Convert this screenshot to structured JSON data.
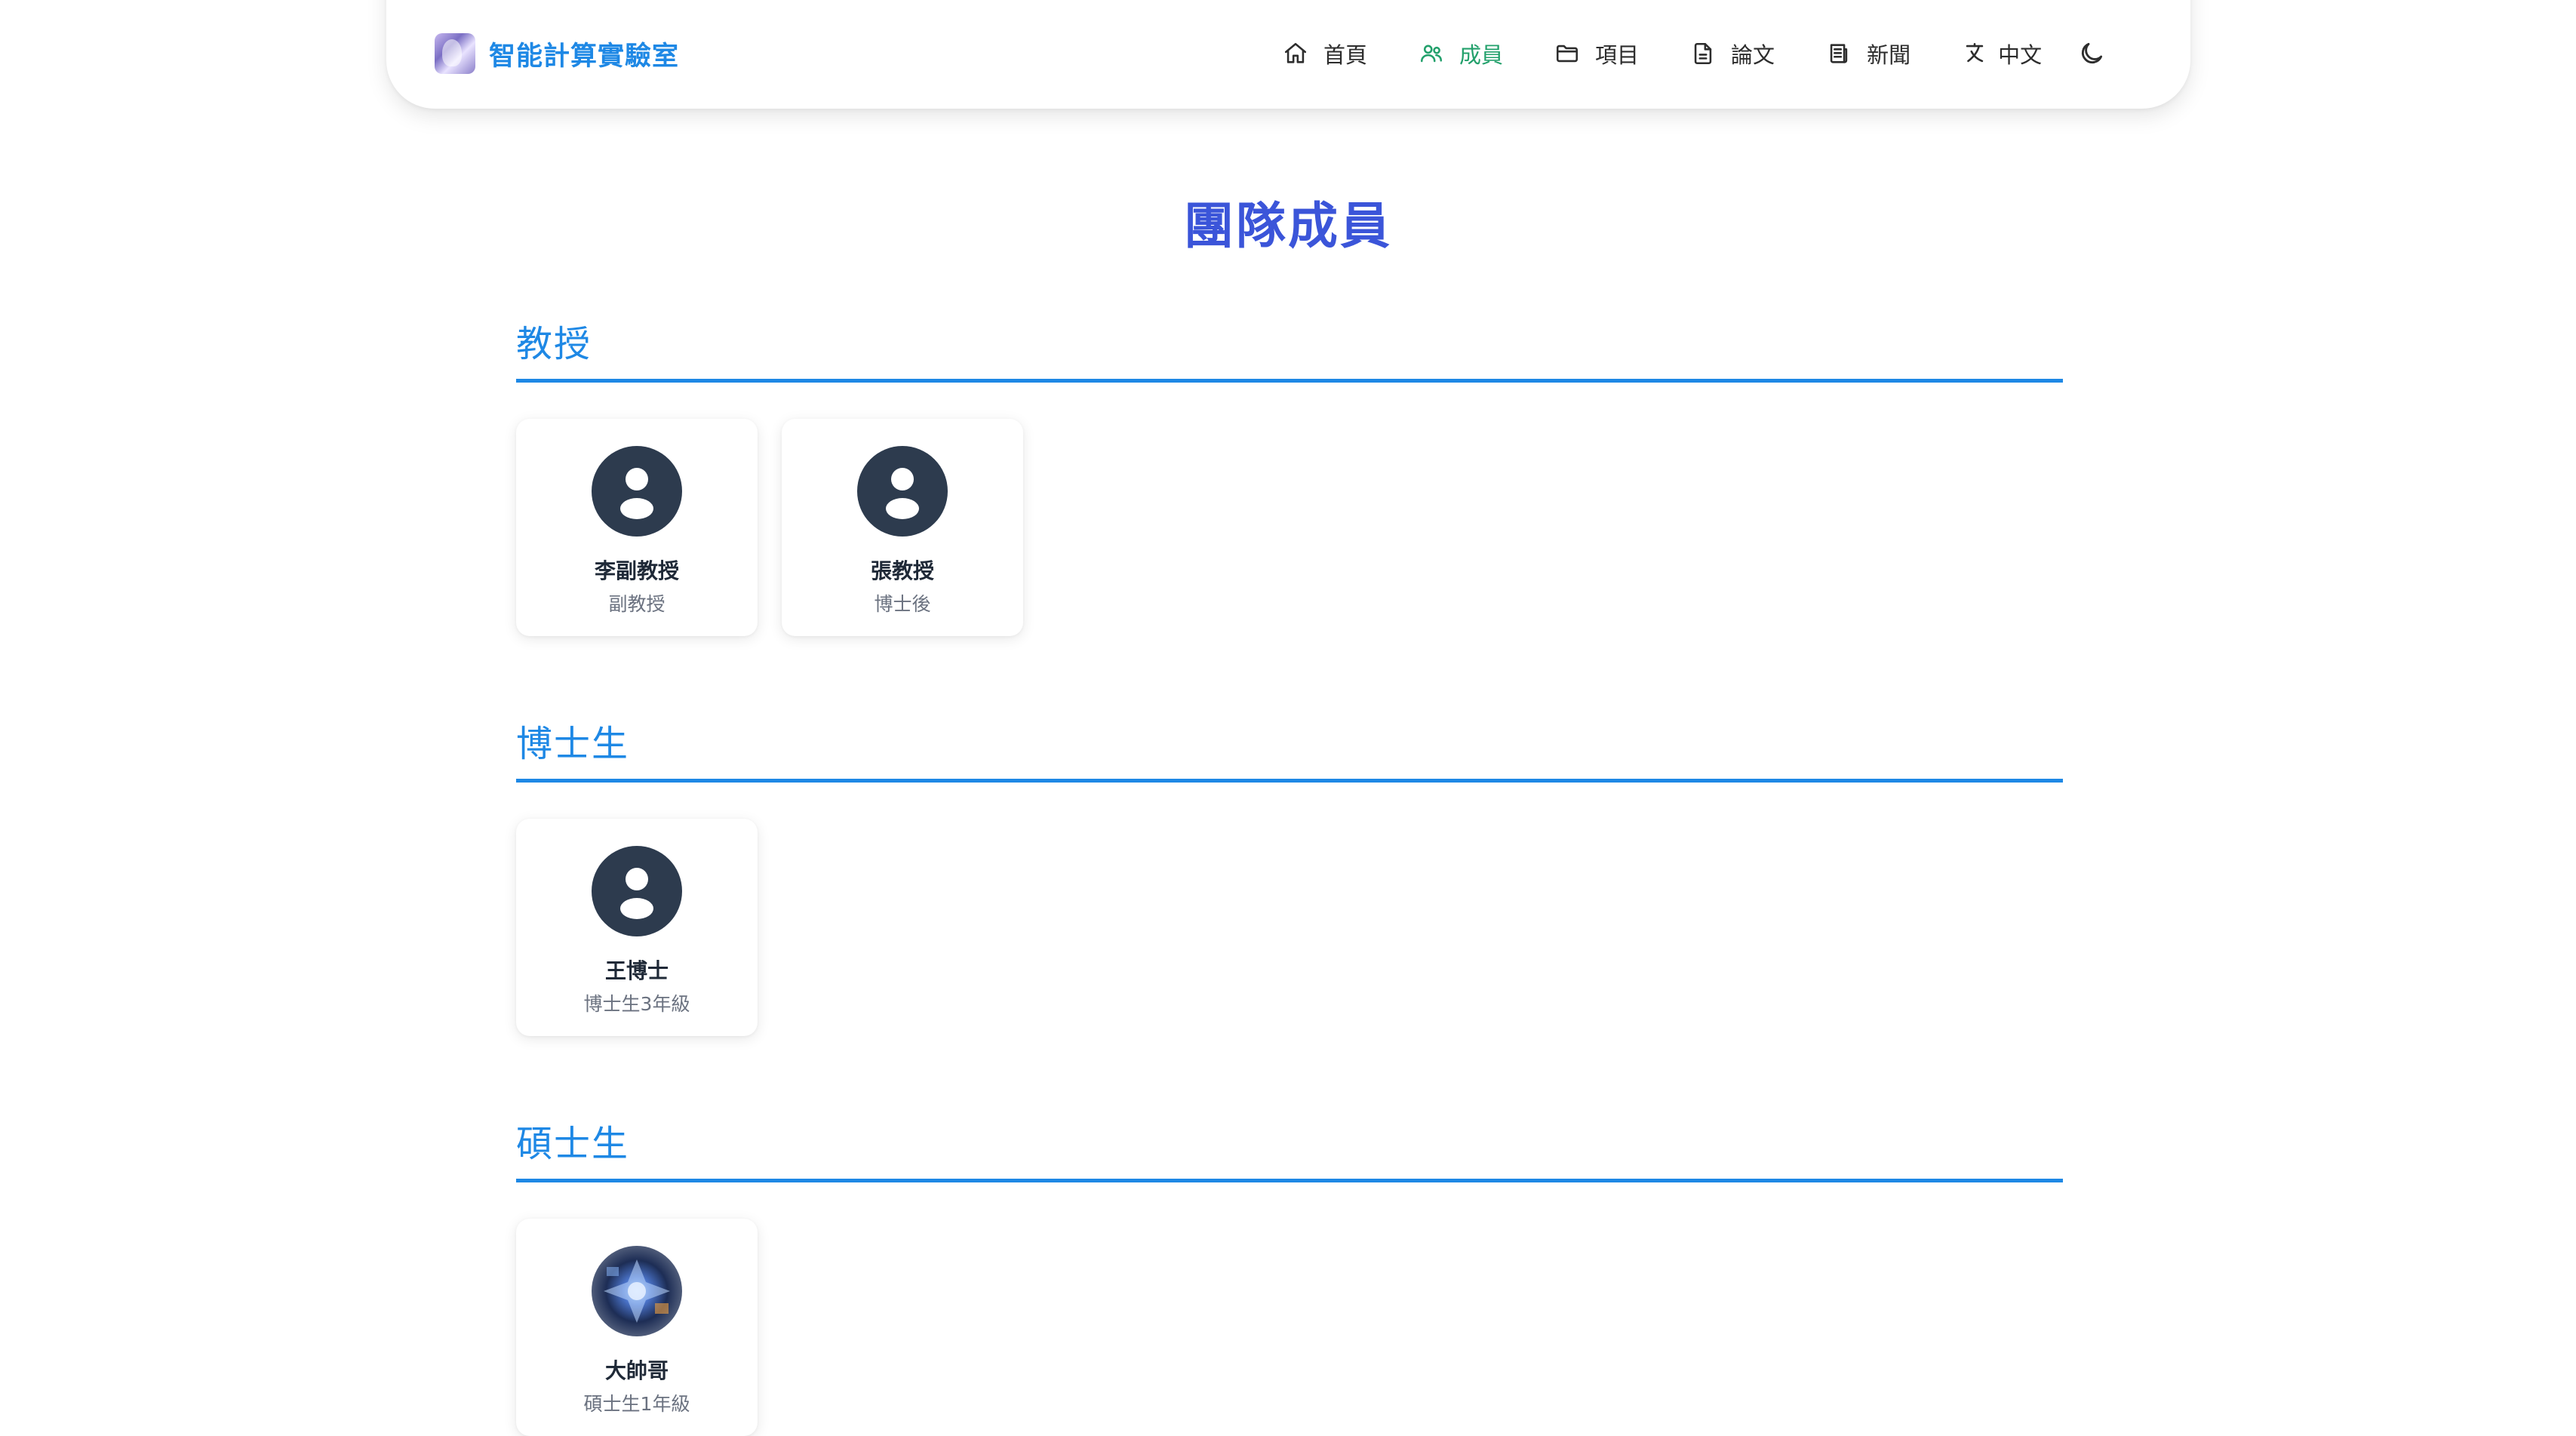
{
  "brand": {
    "name": "智能計算實驗室"
  },
  "nav": {
    "items": [
      {
        "label": "首頁",
        "icon": "home-icon"
      },
      {
        "label": "成員",
        "icon": "users-icon",
        "active": true
      },
      {
        "label": "項目",
        "icon": "folder-icon"
      },
      {
        "label": "論文",
        "icon": "document-icon"
      },
      {
        "label": "新聞",
        "icon": "newspaper-icon"
      }
    ],
    "language": {
      "label": "中文",
      "icon": "translate-icon"
    },
    "theme_icon": "moon-icon"
  },
  "page": {
    "title": "團隊成員"
  },
  "sections": [
    {
      "title": "教授",
      "members": [
        {
          "name": "李副教授",
          "role": "副教授",
          "avatar": "default-avatar-icon"
        },
        {
          "name": "張教授",
          "role": "博士後",
          "avatar": "default-avatar-icon"
        }
      ]
    },
    {
      "title": "博士生",
      "members": [
        {
          "name": "王博士",
          "role": "博士生3年級",
          "avatar": "default-avatar-icon"
        }
      ]
    },
    {
      "title": "碩士生",
      "members": [
        {
          "name": "大帥哥",
          "role": "碩士生1年級",
          "avatar": "photo"
        }
      ]
    }
  ],
  "colors": {
    "brand_blue": "#1e88e5",
    "title_blue": "#3b55d9",
    "active_green": "#22a06b",
    "avatar_dark": "#2d3b4e"
  }
}
